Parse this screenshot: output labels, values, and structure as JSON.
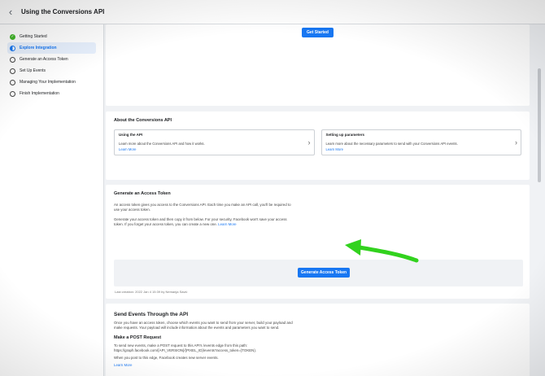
{
  "header": {
    "back_icon": "chevron-left-icon",
    "title": "Using the Conversions API"
  },
  "sidebar": {
    "steps": [
      {
        "label": "Getting Started",
        "state": "done"
      },
      {
        "label": "Explore Integration",
        "state": "active"
      },
      {
        "label": "Generate an Access Token",
        "state": "todo"
      },
      {
        "label": "Set Up Events",
        "state": "todo"
      },
      {
        "label": "Managing Your Implementation",
        "state": "todo"
      },
      {
        "label": "Finish Implementation",
        "state": "todo"
      }
    ]
  },
  "top": {
    "get_started_label": "Get Started"
  },
  "about": {
    "title": "About the Conversions API",
    "boxes": [
      {
        "title": "Using the API",
        "desc": "Learn more about the Conversions API and how it works.",
        "link": "Learn More"
      },
      {
        "title": "Setting up parameters",
        "desc": "Learn more about the necessary parameters to send with your Conversions API events.",
        "link": "Learn More"
      }
    ]
  },
  "token": {
    "title": "Generate an Access Token",
    "para1": "An access token gives you access to the Conversions API. Each time you make an API call, you'll be required to use your access token.",
    "para2": "Generate your access token and then copy it from below. For your security, Facebook won't save your access token. If you forget your access token, you can create a new one.",
    "para2_link": "Learn More",
    "button_label": "Generate Access Token",
    "last_created": "Last creation: 2022 Jan 4 15:39 by Nemanja Savić"
  },
  "send": {
    "title": "Send Events Through the API",
    "para": "Once you have an access token, choose which events you want to send from your server, build your payload and make requests. Your payload will include information about the events and parameters you want to send.",
    "post_title": "Make a POST Request",
    "post_para": "To send new events, make a POST request to this API's /events edge from this path: https://graph.facebook.com/{API_VERSION}/{PIXEL_ID}/events?access_token={TOKEN}.",
    "post_para2": "When you post to this edge, Facebook creates new server events.",
    "link": "Learn More"
  },
  "colors": {
    "accent": "#1877f2",
    "done": "#42b72a",
    "arrow": "#32d21e"
  }
}
